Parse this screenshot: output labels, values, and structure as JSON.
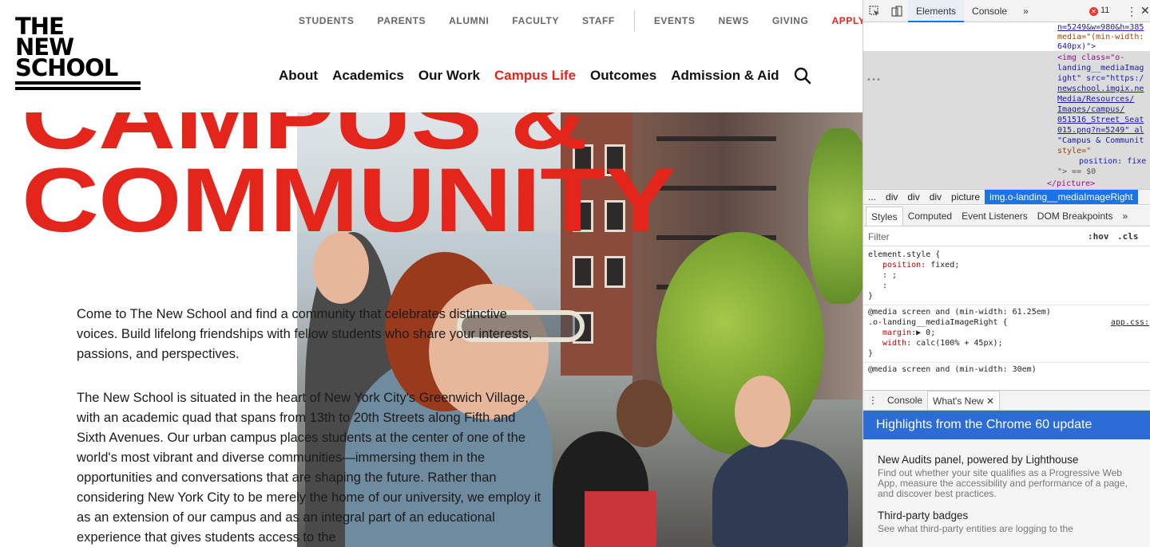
{
  "site": {
    "logo": {
      "lines": [
        "THE",
        "NEW",
        "SCHOOL"
      ]
    },
    "util_nav": [
      "STUDENTS",
      "PARENTS",
      "ALUMNI",
      "FACULTY",
      "STAFF",
      "EVENTS",
      "NEWS",
      "GIVING",
      "APPLY"
    ],
    "main_nav": [
      "About",
      "Academics",
      "Our Work",
      "Campus Life",
      "Outcomes",
      "Admission & Aid"
    ],
    "active_nav": "Campus Life",
    "headline": [
      "CAMPUS &",
      "COMMUNITY"
    ],
    "paragraphs": [
      "Come to The New School and find a community that celebrates distinctive voices. Build lifelong friendships with fellow students who share your interests, passions, and perspectives.",
      "The New School is situated in the heart of New York City's Greenwich Village, with an academic quad that spans from 13th to 20th Streets along Fifth and Sixth Avenues. Our urban campus places students at the center of one of the world's most vibrant and diverse communities—immersing them in the opportunities and conversations that are shaping the future. Rather than considering New York City to be merely the home of our university, we employ it as an extension of our campus and as an integral part of an educational experience that gives students access to the"
    ],
    "colors": {
      "brand_red": "#e3251c",
      "text": "#1b1b1b",
      "nav_gray": "#666666"
    }
  },
  "devtools": {
    "tabs": [
      "Elements",
      "Console"
    ],
    "more": "»",
    "error_count": "11",
    "dom_lines": [
      "n=5249&w=980&h=385",
      "media=\"(min-width:",
      "640px)\">"
    ],
    "img_tag": {
      "l1": "<img class=\"o-",
      "l2": "landing__mediaImag",
      "l3": "ight\" src=\"https:/",
      "l4": "newschool.imgix.ne",
      "l5": "Media/Resources/",
      "l6": "Images/campus/",
      "l7": "051516_Street_Seat",
      "l8": "015.png?n=5249\" al",
      "l9": "\"Campus & Communit",
      "l10": "style=\"",
      "l11": "position: fixe",
      "l12": "\"> == $0",
      "l13": "</picture>"
    },
    "breadcrumbs": [
      "...",
      "div",
      "div",
      "div",
      "picture",
      "img.o-landing__mediaImageRight"
    ],
    "sub_tabs": [
      "Styles",
      "Computed",
      "Event Listeners",
      "DOM Breakpoints",
      "»"
    ],
    "filter_placeholder": "Filter",
    "hov": ":hov",
    "cls": ".cls",
    "styles": {
      "r1_selector": "element.style {",
      "r1_p1_name": "position",
      "r1_p1_val": ": fixed;",
      "r1_p2": ": ;",
      "r1_p3": ":",
      "r1_close": "}",
      "r2_media": "@media screen and (min-width: 61.25em)",
      "r2_selector": ".o-landing__mediaImageRight {",
      "r2_src": "app.css:",
      "r2_p1_name": "margin",
      "r2_p1_val": ":▶ 0;",
      "r2_p2_name": "width",
      "r2_p2_val": ": calc(100% + 45px);",
      "r2_close": "}",
      "r3_media": "@media screen and (min-width: 30em)"
    },
    "drawer_tabs": [
      "Console",
      "What's New"
    ],
    "whats_new_title": "Highlights from the Chrome 60 update",
    "items": [
      {
        "title": "New Audits panel, powered by Lighthouse",
        "desc": "Find out whether your site qualifies as a Progressive Web App, measure the accessibility and performance of a page, and discover best practices."
      },
      {
        "title": "Third-party badges",
        "desc": "See what third-party entities are logging to the"
      }
    ]
  }
}
